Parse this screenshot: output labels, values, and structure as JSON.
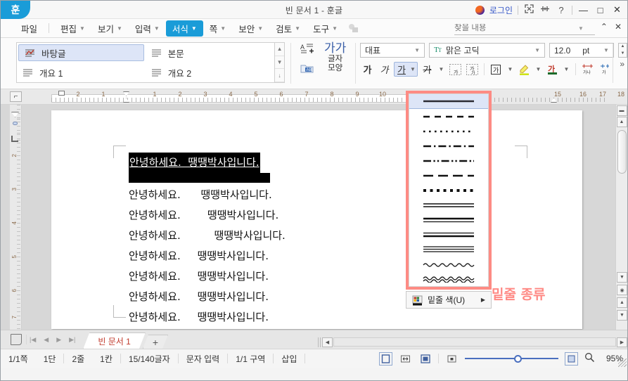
{
  "titlebar": {
    "logo": "훈",
    "title": "빈 문서 1 - 훈글",
    "login_label": "로그인",
    "icons": [
      "expand-icon",
      "sliders-icon",
      "help-icon"
    ],
    "help": "?",
    "minimize": "—",
    "maximize": "□",
    "close": "✕"
  },
  "menubar": {
    "items": [
      {
        "label": "파일",
        "caret": false,
        "active": false
      },
      {
        "label": "편집",
        "caret": true,
        "active": false
      },
      {
        "label": "보기",
        "caret": true,
        "active": false
      },
      {
        "label": "입력",
        "caret": true,
        "active": false
      },
      {
        "label": "서식",
        "caret": true,
        "active": true
      },
      {
        "label": "쪽",
        "caret": true,
        "active": false
      },
      {
        "label": "보안",
        "caret": true,
        "active": false
      },
      {
        "label": "검토",
        "caret": true,
        "active": false
      },
      {
        "label": "도구",
        "caret": true,
        "active": false
      }
    ],
    "find_placeholder": "찾을 내용",
    "find_value": ""
  },
  "ribbon": {
    "styles": [
      {
        "label": "바탕글",
        "selected": true
      },
      {
        "label": "본문",
        "selected": false
      },
      {
        "label": "개요 1",
        "selected": false
      },
      {
        "label": "개요 2",
        "selected": false
      }
    ],
    "char_shape_label_1": "글자",
    "char_shape_label_2": "모양",
    "char_shape_glyph": "가가",
    "style_combo": "대표",
    "font_combo": "맑은 고딕",
    "size_value": "12.0",
    "size_unit": "pt",
    "buttons": [
      {
        "name": "bold",
        "glyph": "가"
      },
      {
        "name": "italic",
        "glyph": "가"
      },
      {
        "name": "underline",
        "glyph": "가",
        "active": true
      },
      {
        "name": "strikethrough",
        "glyph": "가"
      },
      {
        "name": "outline",
        "glyph": "가"
      },
      {
        "name": "shadow",
        "glyph": "가"
      },
      {
        "name": "superscript",
        "glyph": "가"
      },
      {
        "name": "highlight",
        "glyph": "가"
      },
      {
        "name": "font-color",
        "glyph": "가"
      },
      {
        "name": "char-spacing",
        "glyph": "가나"
      },
      {
        "name": "char-width",
        "glyph": "가"
      }
    ],
    "expander": "»"
  },
  "ruler": {
    "h_numbers": [
      "2",
      "1",
      "",
      "1",
      "2",
      "3",
      "4",
      "5",
      "6",
      "7",
      "8",
      "9",
      "10",
      "",
      "",
      "",
      "",
      "15",
      "16",
      "17",
      "18"
    ],
    "v_numbers": [
      "2",
      "3",
      "4",
      "5",
      "6",
      "7"
    ]
  },
  "document": {
    "lines": [
      {
        "text": "안녕하세요.  땡땡박사입니다.",
        "selected": true
      },
      {
        "text": "안녕하세요.      땡땡박사입니다.",
        "selected": false
      },
      {
        "text": "안녕하세요.        땡땡박사입니다.",
        "selected": false
      },
      {
        "text": "안녕하세요.          땡땡박사입니다.",
        "selected": false
      },
      {
        "text": "안녕하세요.     땡땡박사입니다.",
        "selected": false
      },
      {
        "text": "안녕하세요.     땡땡박사입니다.",
        "selected": false
      },
      {
        "text": "안녕하세요.     땡땡박사입니다.",
        "selected": false
      },
      {
        "text": "안녕하세요.     땡땡박사입니다.",
        "selected": false
      }
    ],
    "annotation": "밑줄 종류",
    "annotation_color": "#ff8a85"
  },
  "dropdown": {
    "name": "underline-style-menu",
    "border_color": "#fd8b84",
    "items": [
      {
        "name": "solid-line",
        "selected": true
      },
      {
        "name": "dashed-line",
        "selected": false
      },
      {
        "name": "dotted-line",
        "selected": false
      },
      {
        "name": "dash-dot-line",
        "selected": false
      },
      {
        "name": "dash-dot-dot-line",
        "selected": false
      },
      {
        "name": "long-dash-line",
        "selected": false
      },
      {
        "name": "thick-dotted-line",
        "selected": false
      },
      {
        "name": "double-thin-line",
        "selected": false
      },
      {
        "name": "thick-over-thin-line",
        "selected": false
      },
      {
        "name": "thin-over-thick-line",
        "selected": false
      },
      {
        "name": "triple-line",
        "selected": false
      },
      {
        "name": "wave-line",
        "selected": false
      },
      {
        "name": "double-wave-line",
        "selected": false
      }
    ],
    "footer_label": "밑줄 색(U)",
    "footer_arrow": "▶"
  },
  "tabbar": {
    "nav": [
      "first",
      "prev",
      "next",
      "last"
    ],
    "tab_label": "빈 문서 1",
    "new_tab": "+"
  },
  "statusbar": {
    "items": [
      "1/1쪽",
      "1단",
      "2줄",
      "1칸",
      "15/140글자",
      "문자 입력",
      "1/1 구역",
      "삽입"
    ],
    "zoom": "95%"
  }
}
